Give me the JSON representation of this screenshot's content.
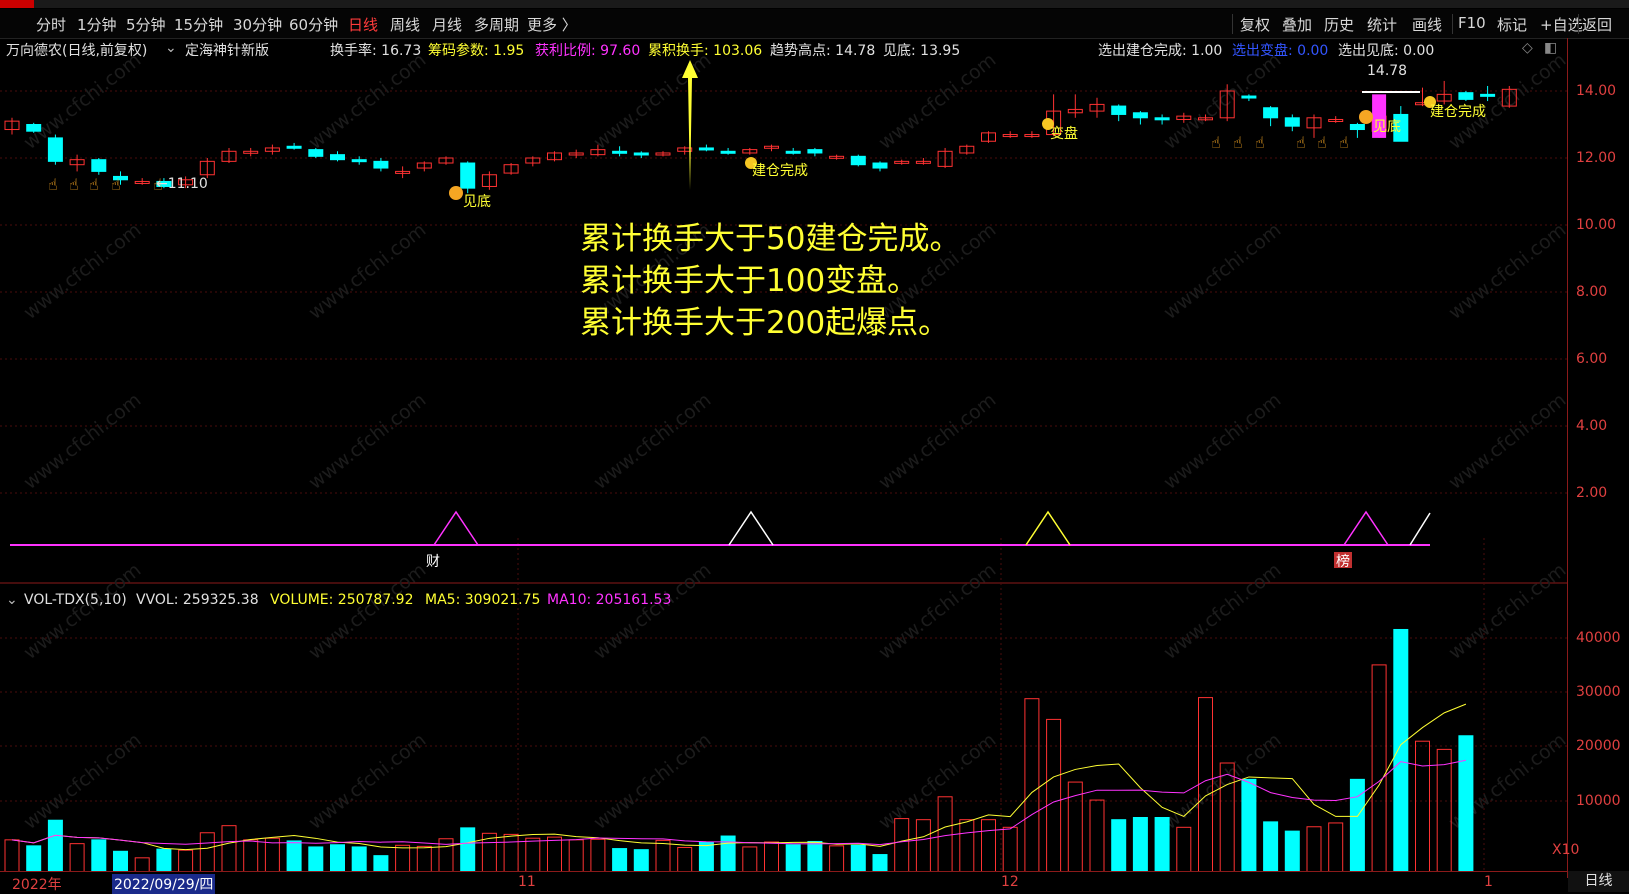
{
  "toolbar": {
    "periods": [
      "分时",
      "1分钟",
      "5分钟",
      "15分钟",
      "30分钟",
      "60分钟",
      "日线",
      "周线",
      "月线",
      "多周期",
      "更多 〉"
    ],
    "active": "日线",
    "right": [
      "复权",
      "叠加",
      "历史",
      "统计",
      "画线",
      "F10",
      "标记",
      "+自选",
      "返回"
    ]
  },
  "info": {
    "stock": "万向德农(日线,前复权)",
    "indicator": "定海神针新版",
    "turnover_label": "换手率: 16.73",
    "chip_param": "筹码参数: 1.95",
    "profit_ratio": "获利比例: 97.60",
    "cum_turnover": "累积换手: 103.06",
    "trend_high": "趋势高点: 14.78",
    "bottom": "见底: 13.95",
    "pick_build": "选出建仓完成: 1.00",
    "pick_change": "选出变盘: 0.00",
    "pick_bottom": "选出见底: 0.00"
  },
  "price_axis": [
    "14.00",
    "12.00",
    "10.00",
    "8.00",
    "6.00",
    "4.00",
    "2.00"
  ],
  "vol_axis": [
    "40000",
    "30000",
    "20000",
    "10000",
    "X10"
  ],
  "annotation": [
    "累计换手大于50建仓完成。",
    "累计换手大于100变盘。",
    "累计换手大于200起爆点。"
  ],
  "labels": {
    "low_price": "←11.10",
    "high_price": "14.78",
    "jiandi": "见底",
    "jiancang": "建仓完成",
    "biangpan": "变盘",
    "cai": "财",
    "bang": "榜"
  },
  "vol_info": {
    "name": "VOL-TDX(5,10)",
    "vvol": "VVOL: 259325.38",
    "volume": "VOLUME: 250787.92",
    "ma5": "MA5: 309021.75",
    "ma10": "MA10: 205161.53"
  },
  "bottom": {
    "year": "2022年",
    "date": "2022/09/29/四",
    "m11": "11",
    "m12": "12",
    "m1": "1",
    "period": "日线"
  },
  "watermark": "www.cfchi.com",
  "colors": {
    "up": "#ff3232",
    "down": "#00ffff",
    "yellow": "#ffff33",
    "magenta": "#ff33ff",
    "blue": "#3355ff",
    "white": "#ffffff",
    "axis": "#8b1a1a"
  },
  "candles": [
    [
      12.85,
      13.1,
      12.7,
      13.2
    ],
    [
      13.0,
      12.8,
      12.75,
      13.05
    ],
    [
      12.6,
      11.9,
      11.8,
      12.7
    ],
    [
      11.8,
      11.95,
      11.6,
      12.1
    ],
    [
      11.95,
      11.6,
      11.5,
      12.0
    ],
    [
      11.45,
      11.35,
      11.2,
      11.6
    ],
    [
      11.25,
      11.3,
      11.2,
      11.4
    ],
    [
      11.3,
      11.15,
      11.1,
      11.4
    ],
    [
      11.2,
      11.35,
      11.1,
      11.45
    ],
    [
      11.5,
      11.9,
      11.4,
      12.0
    ],
    [
      11.9,
      12.2,
      11.85,
      12.3
    ],
    [
      12.15,
      12.2,
      12.05,
      12.3
    ],
    [
      12.2,
      12.3,
      12.1,
      12.4
    ],
    [
      12.35,
      12.3,
      12.25,
      12.45
    ],
    [
      12.25,
      12.05,
      12.0,
      12.3
    ],
    [
      12.1,
      11.95,
      11.9,
      12.2
    ],
    [
      11.95,
      11.9,
      11.8,
      12.05
    ],
    [
      11.9,
      11.7,
      11.6,
      12.0
    ],
    [
      11.6,
      11.6,
      11.4,
      11.75
    ],
    [
      11.7,
      11.85,
      11.6,
      11.9
    ],
    [
      11.85,
      12.0,
      11.8,
      12.05
    ],
    [
      11.85,
      11.1,
      10.95,
      11.9
    ],
    [
      11.15,
      11.5,
      11.05,
      11.6
    ],
    [
      11.55,
      11.8,
      11.5,
      11.85
    ],
    [
      11.85,
      12.0,
      11.75,
      12.05
    ],
    [
      11.95,
      12.15,
      11.9,
      12.2
    ],
    [
      12.1,
      12.15,
      12.0,
      12.25
    ],
    [
      12.1,
      12.25,
      12.05,
      12.4
    ],
    [
      12.2,
      12.15,
      12.05,
      12.35
    ],
    [
      12.15,
      12.1,
      12.0,
      12.2
    ],
    [
      12.1,
      12.15,
      12.05,
      12.2
    ],
    [
      12.2,
      12.3,
      12.1,
      12.35
    ],
    [
      12.3,
      12.25,
      12.2,
      12.4
    ],
    [
      12.2,
      12.15,
      12.1,
      12.3
    ],
    [
      12.15,
      12.25,
      12.1,
      12.3
    ],
    [
      12.3,
      12.35,
      12.2,
      12.4
    ],
    [
      12.2,
      12.15,
      12.1,
      12.3
    ],
    [
      12.25,
      12.15,
      12.05,
      12.3
    ],
    [
      12.0,
      12.05,
      11.95,
      12.1
    ],
    [
      12.05,
      11.8,
      11.75,
      12.1
    ],
    [
      11.85,
      11.7,
      11.6,
      11.9
    ],
    [
      11.85,
      11.9,
      11.8,
      11.95
    ],
    [
      11.9,
      11.9,
      11.8,
      12.0
    ],
    [
      11.75,
      12.2,
      11.7,
      12.3
    ],
    [
      12.15,
      12.35,
      12.1,
      12.4
    ],
    [
      12.5,
      12.75,
      12.45,
      12.8
    ],
    [
      12.65,
      12.7,
      12.6,
      12.8
    ],
    [
      12.65,
      12.7,
      12.6,
      12.8
    ],
    [
      12.7,
      13.4,
      12.65,
      13.9
    ],
    [
      13.35,
      13.45,
      13.2,
      13.9
    ],
    [
      13.4,
      13.6,
      13.2,
      13.8
    ],
    [
      13.55,
      13.3,
      13.1,
      13.6
    ],
    [
      13.35,
      13.2,
      13.0,
      13.4
    ],
    [
      13.2,
      13.15,
      13.0,
      13.3
    ],
    [
      13.15,
      13.25,
      13.05,
      13.35
    ],
    [
      13.15,
      13.2,
      13.1,
      13.3
    ],
    [
      13.2,
      14.0,
      13.1,
      14.2
    ],
    [
      13.85,
      13.8,
      13.7,
      13.9
    ],
    [
      13.5,
      13.2,
      12.95,
      13.55
    ],
    [
      13.2,
      12.95,
      12.8,
      13.3
    ],
    [
      12.9,
      13.2,
      12.6,
      13.3
    ],
    [
      13.15,
      13.15,
      13.05,
      13.25
    ],
    [
      13.0,
      12.85,
      12.6,
      13.05
    ],
    [
      12.8,
      13.25,
      12.6,
      13.35
    ],
    [
      13.3,
      12.5,
      12.5,
      13.55
    ],
    [
      13.65,
      13.65,
      13.55,
      14.1
    ],
    [
      13.7,
      13.9,
      13.6,
      14.3
    ],
    [
      13.95,
      13.75,
      13.7,
      14.0
    ],
    [
      13.9,
      13.85,
      13.7,
      14.15
    ],
    [
      13.55,
      14.05,
      13.5,
      14.15
    ]
  ],
  "volumes": [
    5.9,
    4.8,
    9.5,
    5.2,
    5.9,
    3.8,
    2.6,
    4.2,
    4.0,
    7.2,
    8.5,
    5.9,
    6.2,
    5.7,
    4.6,
    5.0,
    4.6,
    3.0,
    4.9,
    4.7,
    6.1,
    8.1,
    7.1,
    6.9,
    6.2,
    6.4,
    5.9,
    6.0,
    4.3,
    4.1,
    5.8,
    4.5,
    5.5,
    6.6,
    4.6,
    5.5,
    5.0,
    5.6,
    4.8,
    4.9,
    3.2,
    9.8,
    9.6,
    13.8,
    9.6,
    9.6,
    8.2,
    31.8,
    28.0,
    16.5,
    13.2,
    9.6,
    10.0,
    10.0,
    8.2,
    32.0,
    20.0,
    17.0,
    9.2,
    7.5,
    8.3,
    9.0,
    17.0,
    38.0,
    44.5,
    24.0,
    22.5,
    25.0
  ],
  "signal_triangles": [
    21,
    35,
    49,
    65,
    68
  ]
}
